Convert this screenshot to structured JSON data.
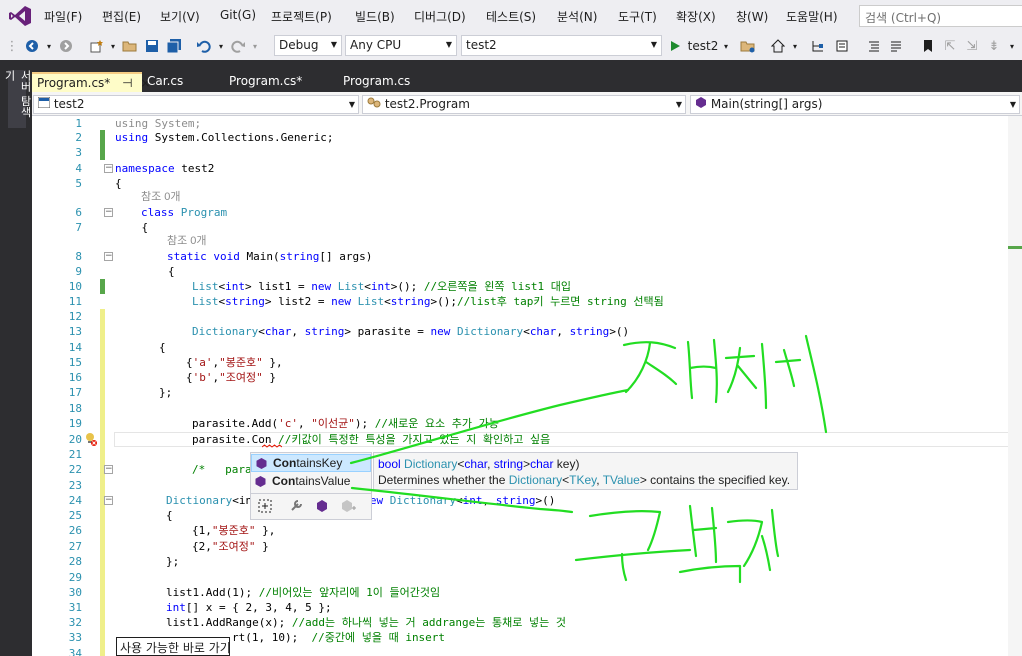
{
  "menu": [
    "파일(F)",
    "편집(E)",
    "보기(V)",
    "Git(G)",
    "프로젝트(P)",
    "빌드(B)",
    "디버그(D)",
    "테스트(S)",
    "분석(N)",
    "도구(T)",
    "확장(X)",
    "창(W)",
    "도움말(H)"
  ],
  "search_placeholder": "검색 (Ctrl+Q)",
  "toolbar": {
    "config": "Debug",
    "platform": "Any CPU",
    "project": "test2",
    "run_label": "test2"
  },
  "side_tab": "서버 탐색기",
  "tabs": [
    {
      "label": "Program.cs*",
      "pin": "⊣",
      "close": "×"
    },
    {
      "label": "Car.cs"
    },
    {
      "label": "Program.cs*"
    },
    {
      "label": "Program.cs"
    }
  ],
  "nav": {
    "project": "test2",
    "class": "test2.Program",
    "method": "Main(string[] args)"
  },
  "refs": "참조 0개",
  "lines": [
    "1",
    "2",
    "3",
    "4",
    "5",
    "6",
    "7",
    "8",
    "9",
    "10",
    "11",
    "12",
    "13",
    "14",
    "15",
    "16",
    "17",
    "18",
    "19",
    "20",
    "21",
    "22",
    "23",
    "24",
    "25",
    "26",
    "27",
    "28",
    "29",
    "30",
    "31",
    "32",
    "33",
    "34"
  ],
  "code": {
    "l1a": "using",
    "l1b": " System;",
    "l2a": "using",
    "l2b": " System.Collections.Generic;",
    "l4a": "namespace",
    "l4b": " test2",
    "l5": "{",
    "l6a": "class",
    "l6b": " Program",
    "l7": "    {",
    "l8a": "static",
    "l8b": "void",
    "l8c": " Main(",
    "l8d": "string",
    "l8e": "[] args)",
    "l9": "        {",
    "l10a": "List",
    "l10b": "<",
    "l10c": "int",
    "l10d": "> list1 = ",
    "l10e": "new",
    "l10f": "List",
    "l10g": "<",
    "l10h": "int",
    "l10i": ">(); ",
    "l10j": "//오른쪽을 왼쪽 list1 대입",
    "l11a": "List",
    "l11b": "<",
    "l11c": "string",
    "l11d": "> list2 = ",
    "l11e": "new",
    "l11f": "List",
    "l11g": "<",
    "l11h": "string",
    "l11i": ">();",
    "l11j": "//list후 tap키 누르면 string 선택됨",
    "l13a": "Dictionary",
    "l13b": "<",
    "l13c": "char",
    "l13d": ", ",
    "l13e": "string",
    "l13f": "> parasite = ",
    "l13g": "new",
    "l13h": "Dictionary",
    "l13i": "<",
    "l13j": "char",
    "l13k": ", ",
    "l13l": "string",
    "l13m": ">()",
    "l14": "{",
    "l15a": "{",
    "l15b": "'a'",
    "l15c": ",",
    "l15d": "\"봉준호\"",
    "l15e": " },",
    "l16a": "{",
    "l16b": "'b'",
    "l16c": ",",
    "l16d": "\"조여정\"",
    "l16e": " }",
    "l17": "};",
    "l19a": "parasite.Add(",
    "l19b": "'c'",
    "l19c": ", ",
    "l19d": "\"이선균\"",
    "l19e": "); ",
    "l19f": "//새로운 요소 추가 가능",
    "l20a": "parasite.Con",
    "l20b": " //키값이 특정한 특성을 가지고 있는 지 확인하고 싶음",
    "l22a": "/*   para",
    "l24a": "Dictionary",
    "l24b": "<in",
    "l24c": "= ",
    "l24d": "new",
    "l24e": "Dictionary",
    "l24f": "<",
    "l24g": "int",
    "l24h": ", ",
    "l24i": "string",
    "l24j": ">()",
    "l25": "{",
    "l26a": "{1,",
    "l26b": "\"봉준호\"",
    "l26c": " },",
    "l27a": "{2,",
    "l27b": "\"조여정\"",
    "l27c": " }",
    "l28": "};",
    "l30a": "list1.Add(1); ",
    "l30b": "//비어있는 앞자리에 1이 들어간것임",
    "l31a": "int",
    "l31b": "[] x = { 2, 3, 4, 5 };",
    "l32a": "list1.AddRange(x); ",
    "l32b": "//add는 하나씩 넣는 거 addrange는 통채로 넣는 것",
    "l33a": "rt(1, 10);  ",
    "l33b": "//중간에 넣을 때 insert"
  },
  "completion": [
    {
      "bold": "Con",
      "rest": "tainsKey"
    },
    {
      "bold": "Con",
      "rest": "tainsValue"
    }
  ],
  "tooltip": {
    "a": "bool ",
    "b": "Dictionary",
    "c": "<",
    "d": "char",
    "e": ", ",
    "f": "string",
    "g": ">",
    ".": ".ContainsKey(",
    "h": "char",
    "i": " key)",
    "desc1": "Determines whether the ",
    "desc2": "Dictionary",
    "desc3": "<",
    "desc4": "TKey",
    "desc5": ", ",
    "desc6": "TValue",
    "desc7": ">",
    "desc8": " contains the specified key."
  },
  "quick_action": "사용 가능한 바로 가기",
  "colors": {
    "accent": "#68217a",
    "ink": "#22dd22",
    "keyword": "#0000ff",
    "type": "#2b91af",
    "string": "#a31515",
    "comment": "#008000"
  }
}
